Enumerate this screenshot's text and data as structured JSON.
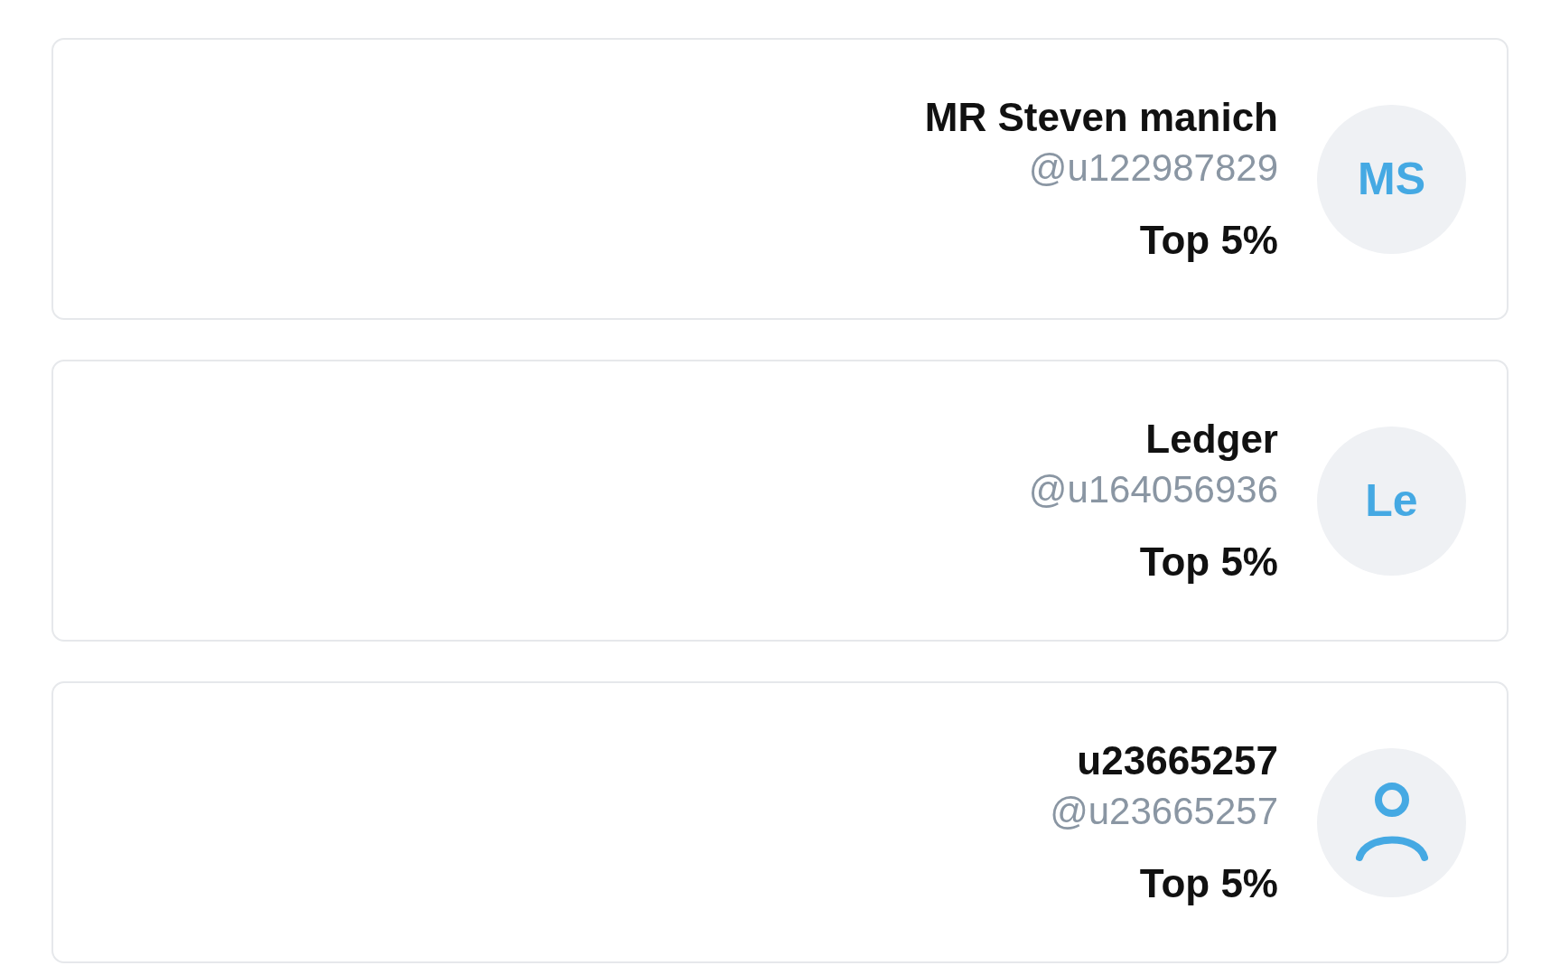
{
  "users": [
    {
      "name": "MR Steven manich",
      "handle": "@u122987829",
      "rank": "Top 5%",
      "avatar": {
        "kind": "initials",
        "text": "MS"
      }
    },
    {
      "name": "Ledger",
      "handle": "@u164056936",
      "rank": "Top 5%",
      "avatar": {
        "kind": "initials",
        "text": "Le"
      }
    },
    {
      "name": "u23665257",
      "handle": "@u23665257",
      "rank": "Top 5%",
      "avatar": {
        "kind": "icon"
      }
    }
  ]
}
